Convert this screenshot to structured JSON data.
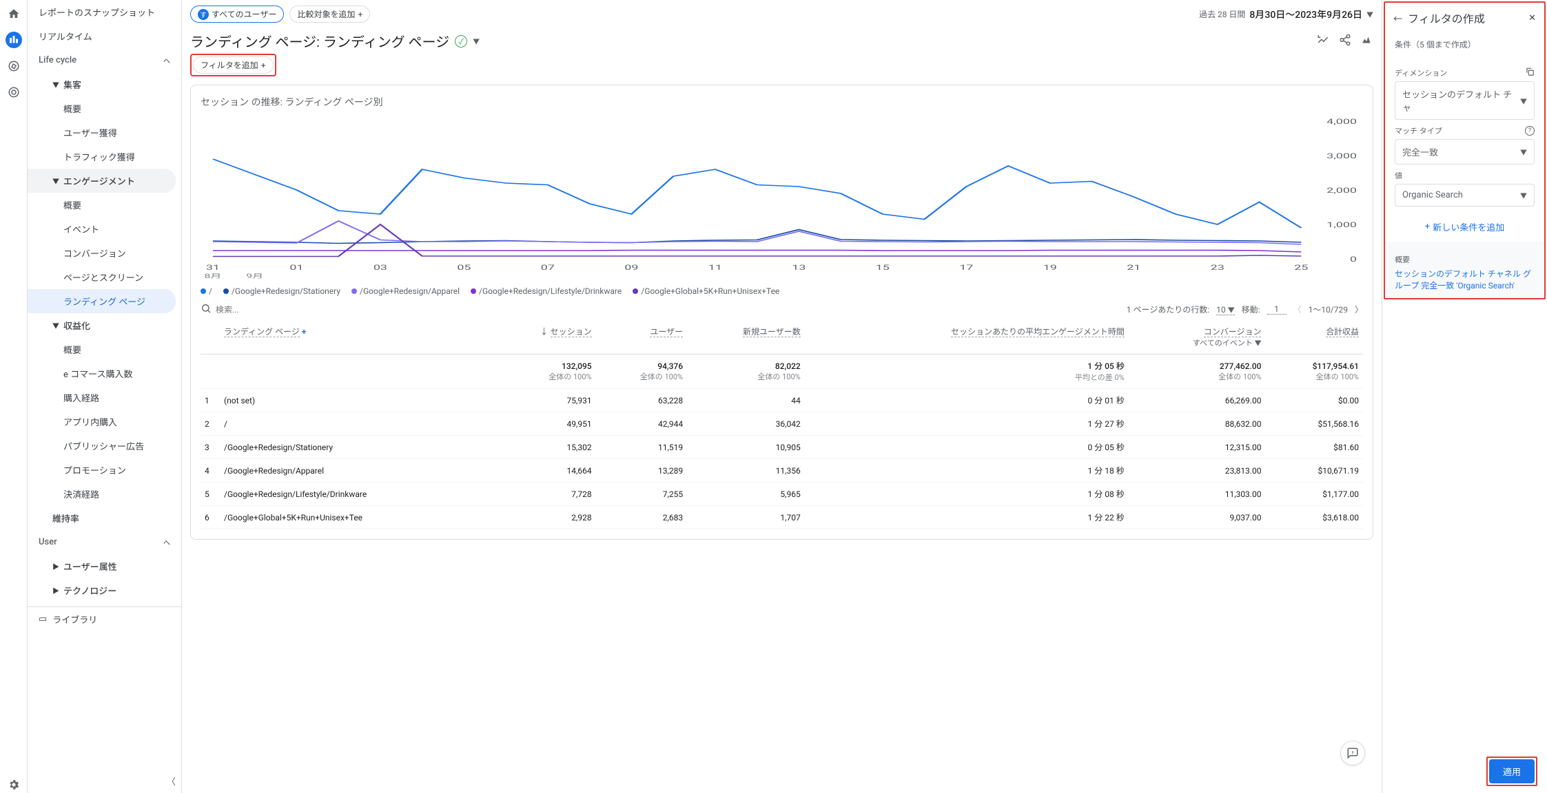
{
  "sidebar": {
    "top": [
      "レポートのスナップショット",
      "リアルタイム"
    ],
    "lifecycle_label": "Life cycle",
    "acq_label": "集客",
    "acq_items": [
      "概要",
      "ユーザー獲得",
      "トラフィック獲得"
    ],
    "eng_label": "エンゲージメント",
    "eng_items": [
      "概要",
      "イベント",
      "コンバージョン",
      "ページとスクリーン",
      "ランディング ページ"
    ],
    "mon_label": "収益化",
    "mon_items": [
      "概要",
      "e コマース購入数",
      "購入経路",
      "アプリ内購入",
      "パブリッシャー広告",
      "プロモーション",
      "決済経路"
    ],
    "retention": "維持率",
    "user_label": "User",
    "user_items": [
      "ユーザー属性",
      "テクノロジー"
    ],
    "library": "ライブラリ"
  },
  "topchips": {
    "all_users_badge": "す",
    "all_users": "すべてのユーザー",
    "add_compare": "比較対象を追加"
  },
  "date": {
    "prefix": "過去 28 日間",
    "range": "8月30日～2023年9月26日"
  },
  "title": "ランディング ページ: ランディング ページ",
  "filter_add": "フィルタを追加",
  "chart": {
    "title_a": "セッション",
    "title_mid": " の推移: ",
    "title_b": "ランディング ページ別",
    "y_ticks": [
      "4,000",
      "3,000",
      "2,000",
      "1,000",
      "0"
    ],
    "x_ticks": [
      "31",
      "01",
      "03",
      "05",
      "07",
      "09",
      "11",
      "13",
      "15",
      "17",
      "19",
      "21",
      "23",
      "25"
    ],
    "x_sub": [
      "8月",
      "9月"
    ],
    "legend": [
      "/",
      "/Google+Redesign/Stationery",
      "/Google+Redesign/Apparel",
      "/Google+Redesign/Lifestyle/Drinkware",
      "/Google+Global+5K+Run+Unisex+Tee"
    ],
    "colors": [
      "#1a73e8",
      "#174ea6",
      "#7b6cf6",
      "#8430ce",
      "#673ab7"
    ]
  },
  "tbl": {
    "search_ph": "検索...",
    "rows_per_page": "1 ページあたりの行数:",
    "rows_val": "10",
    "goto": "移動:",
    "goto_val": "1",
    "page_info": "1～10/729",
    "col_lp": "ランディング ページ",
    "cols": [
      "セッション",
      "ユーザー",
      "新規ユーザー数",
      "セッションあたりの平均エンゲージメント時間",
      "コンバージョン",
      "合計収益"
    ],
    "conv_sub": "すべてのイベント",
    "totals": [
      "132,095",
      "94,376",
      "82,022",
      "1 分 05 秒",
      "277,462.00",
      "$117,954.61"
    ],
    "totals_sub": [
      "全体の 100%",
      "全体の 100%",
      "全体の 100%",
      "平均との差 0%",
      "全体の 100%",
      "全体の 100%"
    ],
    "rows": [
      {
        "n": "1",
        "lp": "(not set)",
        "v": [
          "75,931",
          "63,228",
          "44",
          "0 分 01 秒",
          "66,269.00",
          "$0.00"
        ]
      },
      {
        "n": "2",
        "lp": "/",
        "v": [
          "49,951",
          "42,944",
          "36,042",
          "1 分 27 秒",
          "88,632.00",
          "$51,568.16"
        ]
      },
      {
        "n": "3",
        "lp": "/Google+Redesign/Stationery",
        "v": [
          "15,302",
          "11,519",
          "10,905",
          "0 分 05 秒",
          "12,315.00",
          "$81.60"
        ]
      },
      {
        "n": "4",
        "lp": "/Google+Redesign/Apparel",
        "v": [
          "14,664",
          "13,289",
          "11,356",
          "1 分 18 秒",
          "23,813.00",
          "$10,671.19"
        ]
      },
      {
        "n": "5",
        "lp": "/Google+Redesign/Lifestyle/Drinkware",
        "v": [
          "7,728",
          "7,255",
          "5,965",
          "1 分 08 秒",
          "11,303.00",
          "$1,177.00"
        ]
      },
      {
        "n": "6",
        "lp": "/Google+Global+5K+Run+Unisex+Tee",
        "v": [
          "2,928",
          "2,683",
          "1,707",
          "1 分 22 秒",
          "9,037.00",
          "$3,618.00"
        ]
      }
    ]
  },
  "panel": {
    "title": "フィルタの作成",
    "cond_limit": "条件（5 個まで作成）",
    "dim_label": "ディメンション",
    "dim_val": "セッションのデフォルト チャ",
    "match_label": "マッチ タイプ",
    "match_val": "完全一致",
    "value_label": "値",
    "value_val": "Organic Search",
    "add_cond": "新しい条件を追加",
    "summary_label": "概要",
    "summary_text": "セッションのデフォルト チャネル グループ 完全一致 'Organic Search'",
    "apply": "適用"
  },
  "chart_data": {
    "type": "line",
    "ylim": [
      0,
      4000
    ],
    "x": [
      "8/31",
      "9/01",
      "9/02",
      "9/03",
      "9/04",
      "9/05",
      "9/06",
      "9/07",
      "9/08",
      "9/09",
      "9/10",
      "9/11",
      "9/12",
      "9/13",
      "9/14",
      "9/15",
      "9/16",
      "9/17",
      "9/18",
      "9/19",
      "9/20",
      "9/21",
      "9/22",
      "9/23",
      "9/24",
      "9/25",
      "9/26"
    ],
    "series": [
      {
        "name": "/",
        "color": "#1a73e8",
        "values": [
          2900,
          2450,
          2000,
          1400,
          1300,
          2600,
          2350,
          2200,
          2150,
          1600,
          1300,
          2400,
          2600,
          2150,
          2100,
          1900,
          1300,
          1150,
          2100,
          2700,
          2200,
          2250,
          1800,
          1300,
          1000,
          1650,
          900
        ]
      },
      {
        "name": "/Google+Redesign/Stationery",
        "color": "#174ea6",
        "values": [
          520,
          500,
          480,
          450,
          470,
          500,
          520,
          530,
          500,
          480,
          470,
          520,
          540,
          550,
          850,
          560,
          540,
          530,
          520,
          530,
          540,
          550,
          560,
          540,
          530,
          520,
          480
        ]
      },
      {
        "name": "/Google+Redesign/Apparel",
        "color": "#7b6cf6",
        "values": [
          500,
          480,
          460,
          1100,
          550,
          500,
          500,
          520,
          500,
          480,
          470,
          500,
          510,
          500,
          800,
          510,
          500,
          490,
          500,
          510,
          500,
          500,
          500,
          490,
          480,
          470,
          420
        ]
      },
      {
        "name": "/Google+Redesign/Lifestyle/Drinkware",
        "color": "#8430ce",
        "values": [
          240,
          240,
          240,
          240,
          240,
          240,
          240,
          240,
          240,
          240,
          250,
          250,
          250,
          250,
          250,
          250,
          240,
          240,
          240,
          240,
          250,
          250,
          250,
          250,
          250,
          240,
          200
        ]
      },
      {
        "name": "/Google+Global+5K+Run+Unisex+Tee",
        "color": "#673ab7",
        "values": [
          70,
          70,
          70,
          70,
          1000,
          80,
          80,
          80,
          80,
          80,
          80,
          80,
          80,
          80,
          80,
          80,
          80,
          80,
          80,
          80,
          80,
          80,
          80,
          80,
          80,
          100,
          80
        ]
      }
    ]
  }
}
